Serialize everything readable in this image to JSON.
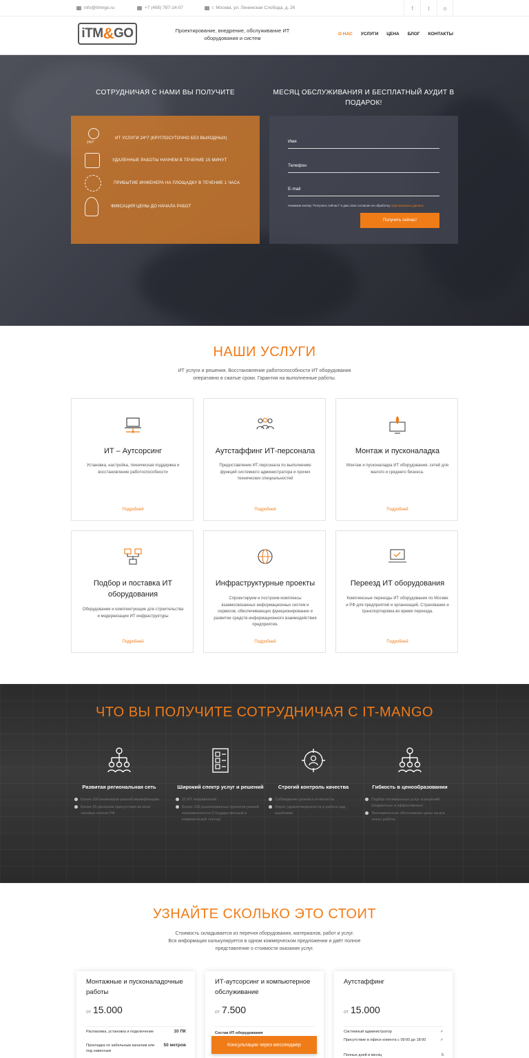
{
  "topbar": {
    "email": "info@itmngo.ru",
    "phone": "+7 (495) 787-14-07",
    "address": "г. Москва, ул. Ленинская Слобода, д. 26",
    "social": [
      "f",
      "t",
      "o"
    ]
  },
  "header": {
    "logo_left": "iTM",
    "logo_amp": "&",
    "logo_right": "GO",
    "tagline": "Проектирование, внедрение, обслуживание ИТ оборудования и систем",
    "nav": [
      "О НАС",
      "УСЛУГИ",
      "ЦЕНА",
      "БЛОГ",
      "КОНТАКТЫ"
    ]
  },
  "hero": {
    "left_title": "СОТРУДНИЧАЯ С НАМИ ВЫ ПОЛУЧИТЕ",
    "right_title": "МЕСЯЦ ОБСЛУЖИВАНИЯ И БЕСПЛАТНЫЙ АУДИТ В ПОДАРОК!",
    "benefits": [
      "ИТ УСЛУГИ 24*7 (КРУГЛОСУТОЧНО БЕЗ ВЫХОДНЫХ)",
      "УДАЛЕННЫЕ РАБОТЫ НАЧНЕМ В ТЕЧЕНИЕ 15 МИНУТ",
      "ПРИБЫТИЕ ИНЖЕНЕРА НА ПЛОЩАДКУ В ТЕЧЕНИЕ 1 ЧАСА",
      "ФИКСАЦИЯ ЦЕНЫ ДО НАЧАЛА РАБОТ"
    ],
    "benefit_icon_label": "24/7",
    "form": {
      "name_label": "Имя",
      "phone_label": "Телефон",
      "email_label": "E-mail",
      "consent": "Нажимая кнопку \"Получить сейчас!\" я даю свое согласие на обработку ",
      "consent_link": "персональных данных",
      "submit": "Получить сейчас!"
    }
  },
  "services": {
    "title": "НАШИ УСЛУГИ",
    "subtitle_1": "ИТ услуги и решения. Восстановление работоспособности ИТ оборудования",
    "subtitle_2": "оперативно в сжатые сроки. Гарантия на выполненные работы.",
    "more": "Подробней",
    "cards": [
      {
        "title": "ИТ – Аутсорсинг",
        "desc": "Установка, настройка, техническая поддержка и восстановление работоспособности",
        "icon": "laptop-icon"
      },
      {
        "title": "Аутстаффинг ИТ-персонала",
        "desc": "Предоставление ИТ-персонала по выполнению функций системного администратора и прочих технических специальностей",
        "icon": "people-icon"
      },
      {
        "title": "Монтаж и пусконаладка",
        "desc": "Монтаж и пусконаладка ИТ оборудования, сетей для малого и среднего бизнеса.",
        "icon": "rocket-icon"
      },
      {
        "title": "Подбор и поставка ИТ оборудования",
        "desc": "Оборудование и комплектующие для строительства и модернизации ИТ инфраструктуры",
        "icon": "network-icon"
      },
      {
        "title": "Инфраструктурные проекты",
        "desc": "Спроектируем и построим комплексы взаимосвязанных информационных систем и сервисов, обеспечивающих функционирование и развитие средств информационного взаимодействия предприятия.",
        "icon": "globe-icon"
      },
      {
        "title": "Переезд ИТ оборудования",
        "desc": "Комплексные переезды ИТ оборудования по Москве и РФ для предприятий и организаций. Страхование и транспортировка во время переезда.",
        "icon": "monitor-check-icon"
      }
    ]
  },
  "benefits_section": {
    "title": "ЧТО ВЫ ПОЛУЧИТЕ СОТРУДНИЧАЯ С IT-MANGO",
    "items": [
      {
        "title": "Развитая региональная сеть",
        "points": [
          "Более 100 инженеров разной квалификации",
          "Более 25 регионов присутствия во всех часовых поясах РФ"
        ],
        "icon": "hierarchy-icon"
      },
      {
        "title": "Широкий спектр услуг и решений",
        "points": [
          "15 ИТ направлений",
          "Более 100 реализованных проектов разной направленности (Государственный и коммерческий сектор)"
        ],
        "icon": "checklist-icon"
      },
      {
        "title": "Строгий контроль качества",
        "points": [
          "Соблюдение сроков и отчетности",
          "Опрос удовлетворенности и работа над ошибками"
        ],
        "icon": "target-user-icon"
      },
      {
        "title": "Гибкость в ценообразовании",
        "points": [
          "Подбор оптимальных услуг и решений (бюджетные и эффективные)",
          "Экономическое обоснование цены на все этапы работы"
        ],
        "icon": "hierarchy-icon"
      }
    ]
  },
  "pricing": {
    "title": "УЗНАЙТЕ СКОЛЬКО ЭТО СТОИТ",
    "subtitle_1": "Стоимость складывается из перечня оборудования, материалов, работ и услуг.",
    "subtitle_2": "Вся информация калькулируется в одном коммерческом предложении и даёт полное",
    "subtitle_3": "представление о стоимости оказания услуг.",
    "from": "от",
    "cards": [
      {
        "title": "Монтажные и пусконаладочные работы",
        "price": "15.000",
        "rows": [
          [
            "Распаковка, установка и подключение",
            "10 ПК"
          ],
          [
            "Прокладка по кабельным каналам или под навесным",
            "50 метров"
          ]
        ]
      },
      {
        "title": "ИТ-аутсорсинг и компьютерное обслуживание",
        "price": "7.500",
        "rows": [
          [
            "Состав ИТ-оборудования",
            ""
          ]
        ]
      },
      {
        "title": "Аутстаффинг",
        "price": "15.000",
        "rows": [
          [
            "Системный администратор",
            "✓"
          ],
          [
            "Присутствие в офисе клиента с 09:00 до 18:00",
            "✓"
          ],
          [
            "Полных дней в месяц",
            "5"
          ]
        ]
      }
    ],
    "cta": "Консультация через мессенджер"
  }
}
